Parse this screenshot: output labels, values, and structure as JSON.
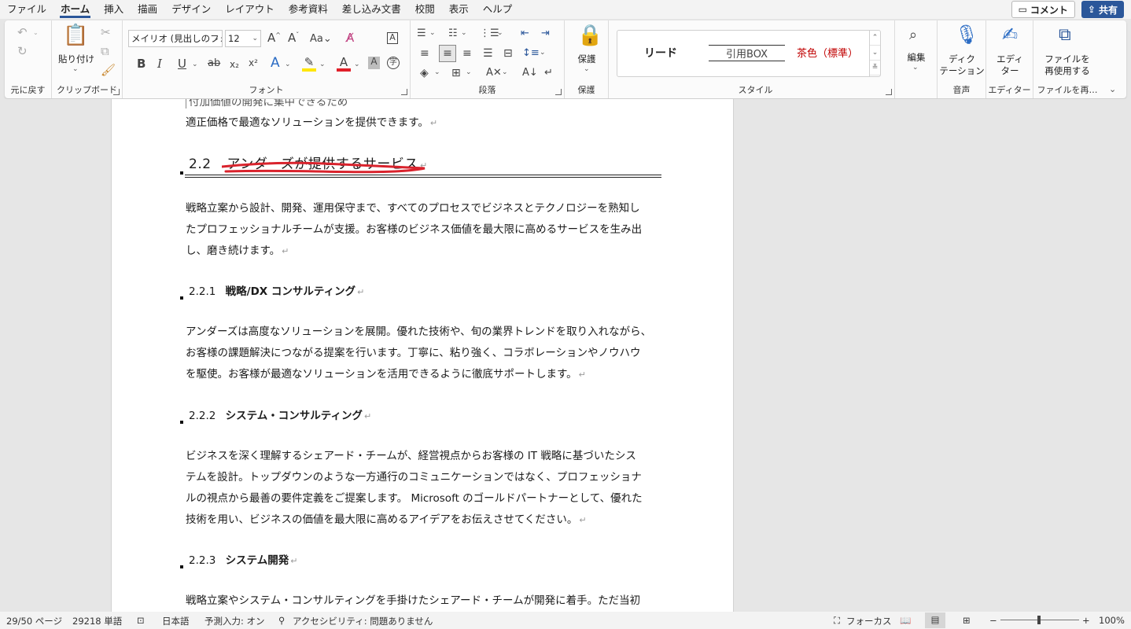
{
  "menu": {
    "tabs": [
      "ファイル",
      "ホーム",
      "挿入",
      "描画",
      "デザイン",
      "レイアウト",
      "参考資料",
      "差し込み文書",
      "校閲",
      "表示",
      "ヘルプ"
    ],
    "active_tab": "ホーム",
    "comment_label": "コメント",
    "share_label": "共有"
  },
  "ribbon": {
    "undo_group": "元に戻す",
    "clipboard_group": "クリップボード",
    "paste_label": "貼り付け",
    "font_group": "フォント",
    "font_name": "メイリオ (見出しのフォント",
    "font_size": "12",
    "paragraph_group": "段落",
    "protect_group": "保護",
    "protect_label": "保護",
    "styles_group": "スタイル",
    "style_items": [
      "リード",
      "引用BOX",
      "茶色（標準）"
    ],
    "edit_label": "編集",
    "dictation_label1": "ディク",
    "dictation_label2": "テーション",
    "voice_group": "音声",
    "editor_label1": "エディ",
    "editor_label2": "ター",
    "editor_group": "エディター",
    "reuse_label1": "ファイルを",
    "reuse_label2": "再使用する",
    "reuse_group": "ファイルを再…"
  },
  "document": {
    "cut_line": "付加価値の開発に集中できるため",
    "line_top": "適正価格で最適なソリューションを提供できます。",
    "h2_number": "2.2",
    "h2_title": "アンダーズが提供するサービス",
    "p1": [
      "戦略立案から設計、開発、運用保守まで、すべてのプロセスでビジネスとテクノロジーを熟知し",
      "たプロフェッショナルチームが支援。お客様のビジネス価値を最大限に高めるサービスを生み出",
      "し、磨き続けます。"
    ],
    "h3_1_number": "2.2.1",
    "h3_1_title": "戦略/DX コンサルティング",
    "p2": [
      "アンダーズは高度なソリューションを展開。優れた技術や、旬の業界トレンドを取り入れながら、",
      "お客様の課題解決につながる提案を行います。丁寧に、粘り強く、コラボレーションやノウハウ",
      "を駆使。お客様が最適なソリューションを活用できるように徹底サポートします。"
    ],
    "h3_2_number": "2.2.2",
    "h3_2_title": "システム・コンサルティング",
    "p3": [
      "ビジネスを深く理解するシェアード・チームが、経営視点からお客様の IT 戦略に基づいたシス",
      "テムを設計。トップダウンのような一方通行のコミュニケーションではなく、プロフェッショナ",
      "ルの視点から最善の要件定義をご提案します。 Microsoft のゴールドパートナーとして、優れた",
      "技術を用い、ビジネスの価値を最大限に高めるアイデアをお伝えさせてください。"
    ],
    "h3_3_number": "2.2.3",
    "h3_3_title": "システム開発",
    "p4_first": "戦略立案やシステム・コンサルティングを手掛けたシェアード・チームが開発に着手。ただ当初"
  },
  "status": {
    "page": "29/50 ページ",
    "words": "29218 単語",
    "language": "日本語",
    "predict": "予測入力: オン",
    "accessibility": "アクセシビリティ: 問題ありません",
    "focus": "フォーカス",
    "zoom": "100%"
  },
  "colors": {
    "accent": "#2b579a",
    "red_underline": "#d9232d",
    "style_brown": "#c00000"
  }
}
